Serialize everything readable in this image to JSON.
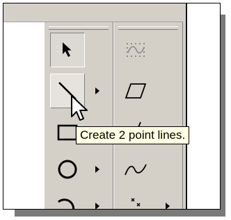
{
  "tooltip": {
    "text": "Create 2 point lines."
  },
  "tools": {
    "column1": [
      {
        "name": "select-arrow-icon"
      },
      {
        "name": "line-icon",
        "flyout": true
      },
      {
        "name": "rectangle-icon",
        "flyout": true
      },
      {
        "name": "circle-icon",
        "flyout": true
      },
      {
        "name": "arc-icon",
        "flyout": true
      }
    ],
    "column2": [
      {
        "name": "dotted-spline-icon"
      },
      {
        "name": "parallelogram-icon"
      },
      {
        "name": "slant-line-icon"
      },
      {
        "name": "spline-icon"
      },
      {
        "name": "point-icon",
        "flyout": true
      }
    ]
  },
  "colors": {
    "toolbar": "#d4d0c8",
    "tooltip_bg": "#ffffe1",
    "shadow": "#7a7a7a"
  }
}
